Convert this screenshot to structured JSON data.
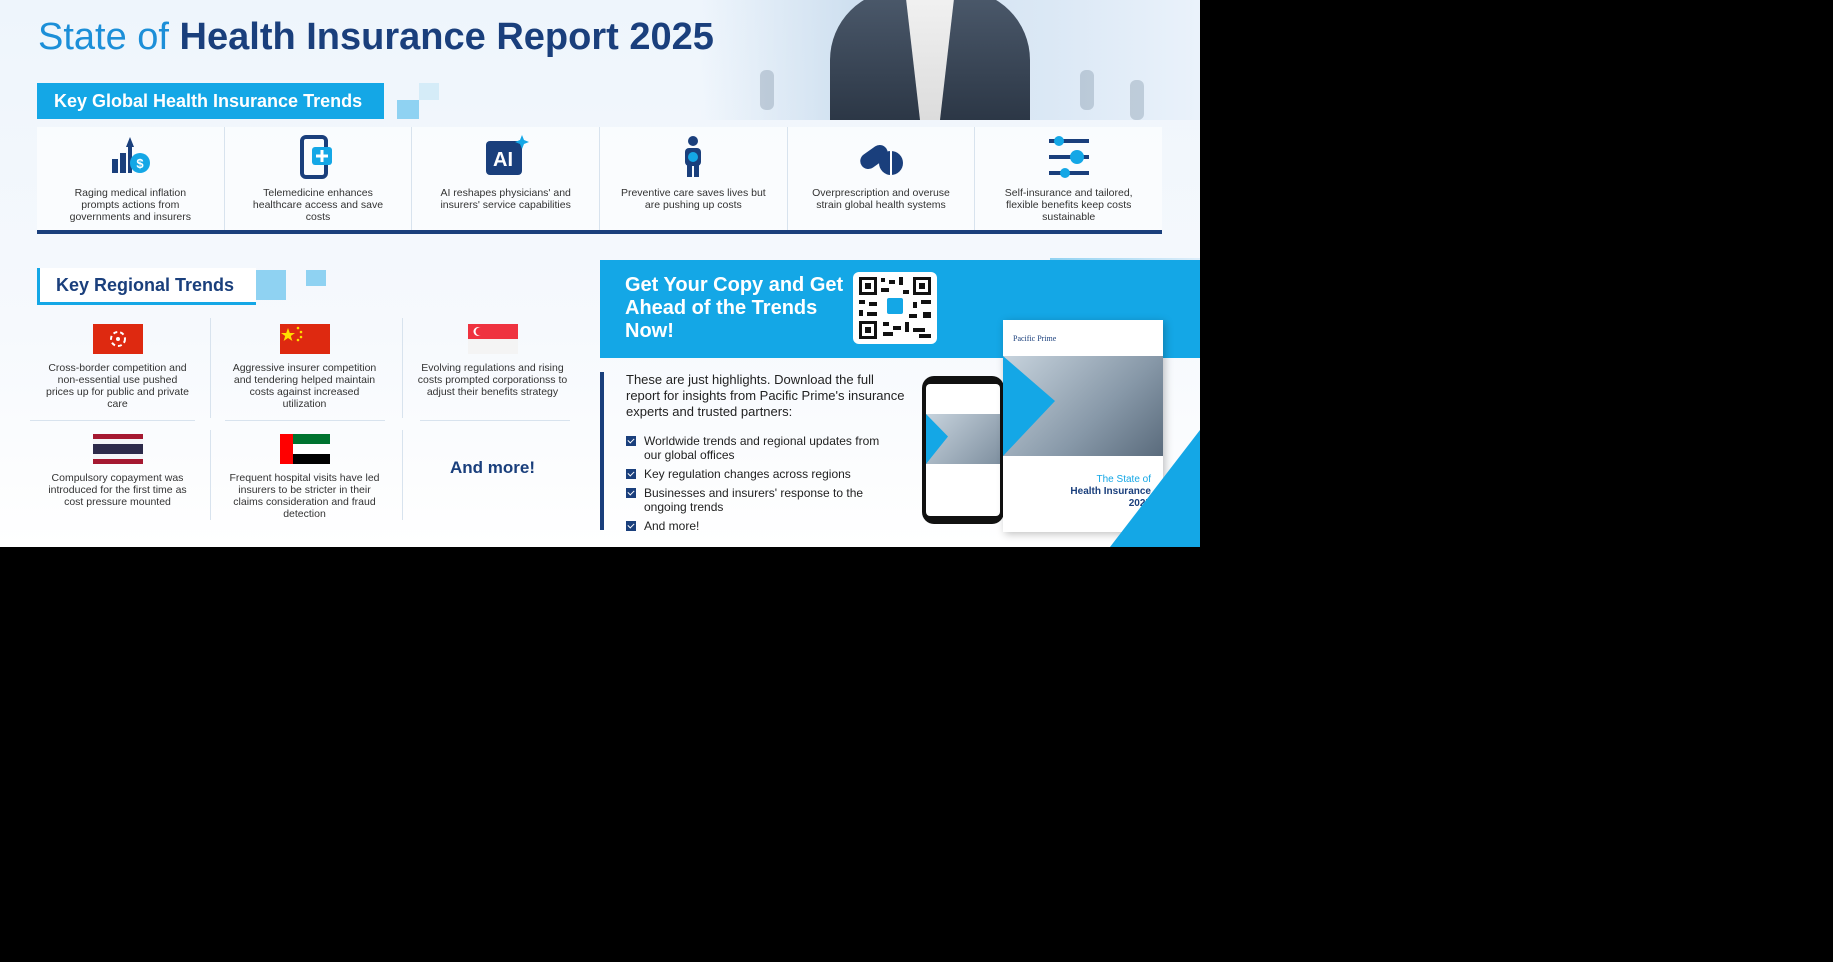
{
  "header": {
    "title_light": "State of",
    "title_bold": "Health Insurance Report 2025"
  },
  "global_trends": {
    "label": "Key Global Health Insurance Trends",
    "items": [
      {
        "icon": "rising-cost-chart-icon",
        "text": "Raging medical inflation prompts actions from governments and insurers"
      },
      {
        "icon": "telemedicine-tablet-icon",
        "text": "Telemedicine enhances healthcare access and save costs"
      },
      {
        "icon": "ai-chip-icon",
        "text": "AI reshapes physicians' and insurers' service capabilities"
      },
      {
        "icon": "body-checkup-icon",
        "text": "Preventive care saves lives but are pushing up costs"
      },
      {
        "icon": "pills-icon",
        "text": "Overprescription and overuse strain global health systems"
      },
      {
        "icon": "adjust-benefits-icon",
        "text": "Self-insurance and tailored, flexible benefits keep costs sustainable"
      }
    ]
  },
  "regional_trends": {
    "label": "Key Regional Trends",
    "items": [
      {
        "flag": "hong-kong-flag-icon",
        "text": "Cross-border competition and non-essential use pushed prices up for public and private care"
      },
      {
        "flag": "china-flag-icon",
        "text": "Aggressive insurer competition and tendering helped maintain costs against increased utilization"
      },
      {
        "flag": "singapore-flag-icon",
        "text": "Evolving regulations and rising costs prompted corporationss to adjust their benefits strategy"
      },
      {
        "flag": "thailand-flag-icon",
        "text": "Compulsory copayment was introduced for the first time as cost pressure mounted"
      },
      {
        "flag": "uae-flag-icon",
        "text": "Frequent hospital visits have led insurers to be stricter in their claims consideration and fraud detection"
      }
    ],
    "and_more": "And more!"
  },
  "cta": {
    "title": "Get Your Copy and Get Ahead of the Trends Now!",
    "intro": "These are just highlights. Download the full report for insights from Pacific Prime's insurance experts and trusted partners:",
    "bullets": [
      "Worldwide trends and regional updates from our global offices",
      "Key regulation changes across regions",
      "Businesses and insurers' response to the ongoing trends",
      "And more!"
    ]
  },
  "book": {
    "brand": "Pacific Prime",
    "title_line1": "The State of",
    "title_line2": "Health Insurance",
    "title_line3": "2025"
  },
  "colors": {
    "brand_navy": "#1a3f7c",
    "accent_blue": "#14a7e6",
    "title_blue": "#1c8fd8"
  }
}
